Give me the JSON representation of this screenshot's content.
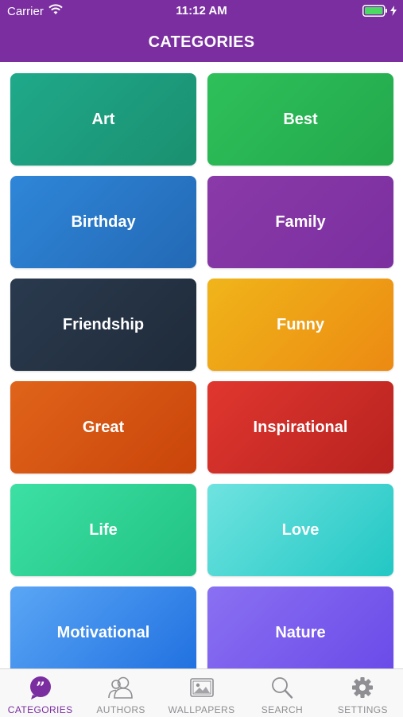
{
  "status_bar": {
    "carrier": "Carrier",
    "time": "11:12 AM"
  },
  "nav": {
    "title": "CATEGORIES"
  },
  "colors": {
    "brand": "#7a2ea0",
    "tab_inactive": "#8e8e93"
  },
  "categories": [
    {
      "label": "Art",
      "from": "#1fa98a",
      "to": "#1a9070"
    },
    {
      "label": "Best",
      "from": "#2ec05a",
      "to": "#23a84c"
    },
    {
      "label": "Birthday",
      "from": "#2f86d8",
      "to": "#2369b5"
    },
    {
      "label": "Family",
      "from": "#8a3aa8",
      "to": "#7b2fa0"
    },
    {
      "label": "Friendship",
      "from": "#2a3a4e",
      "to": "#1f2b3a"
    },
    {
      "label": "Funny",
      "from": "#f0b51a",
      "to": "#ec8a12"
    },
    {
      "label": "Great",
      "from": "#e0641a",
      "to": "#c9440a"
    },
    {
      "label": "Inspirational",
      "from": "#e0372f",
      "to": "#b8221f"
    },
    {
      "label": "Life",
      "from": "#3de0a4",
      "to": "#21c283"
    },
    {
      "label": "Love",
      "from": "#6fe3e0",
      "to": "#22c7c4"
    },
    {
      "label": "Motivational",
      "from": "#5aa6f5",
      "to": "#1f6fe0"
    },
    {
      "label": "Nature",
      "from": "#8a70f2",
      "to": "#6a4ae8"
    }
  ],
  "tabs": [
    {
      "label": "CATEGORIES",
      "icon": "quote-bubble-icon",
      "active": true
    },
    {
      "label": "AUTHORS",
      "icon": "authors-icon",
      "active": false
    },
    {
      "label": "WALLPAPERS",
      "icon": "wallpaper-icon",
      "active": false
    },
    {
      "label": "SEARCH",
      "icon": "search-icon",
      "active": false
    },
    {
      "label": "SETTINGS",
      "icon": "gear-icon",
      "active": false
    }
  ]
}
